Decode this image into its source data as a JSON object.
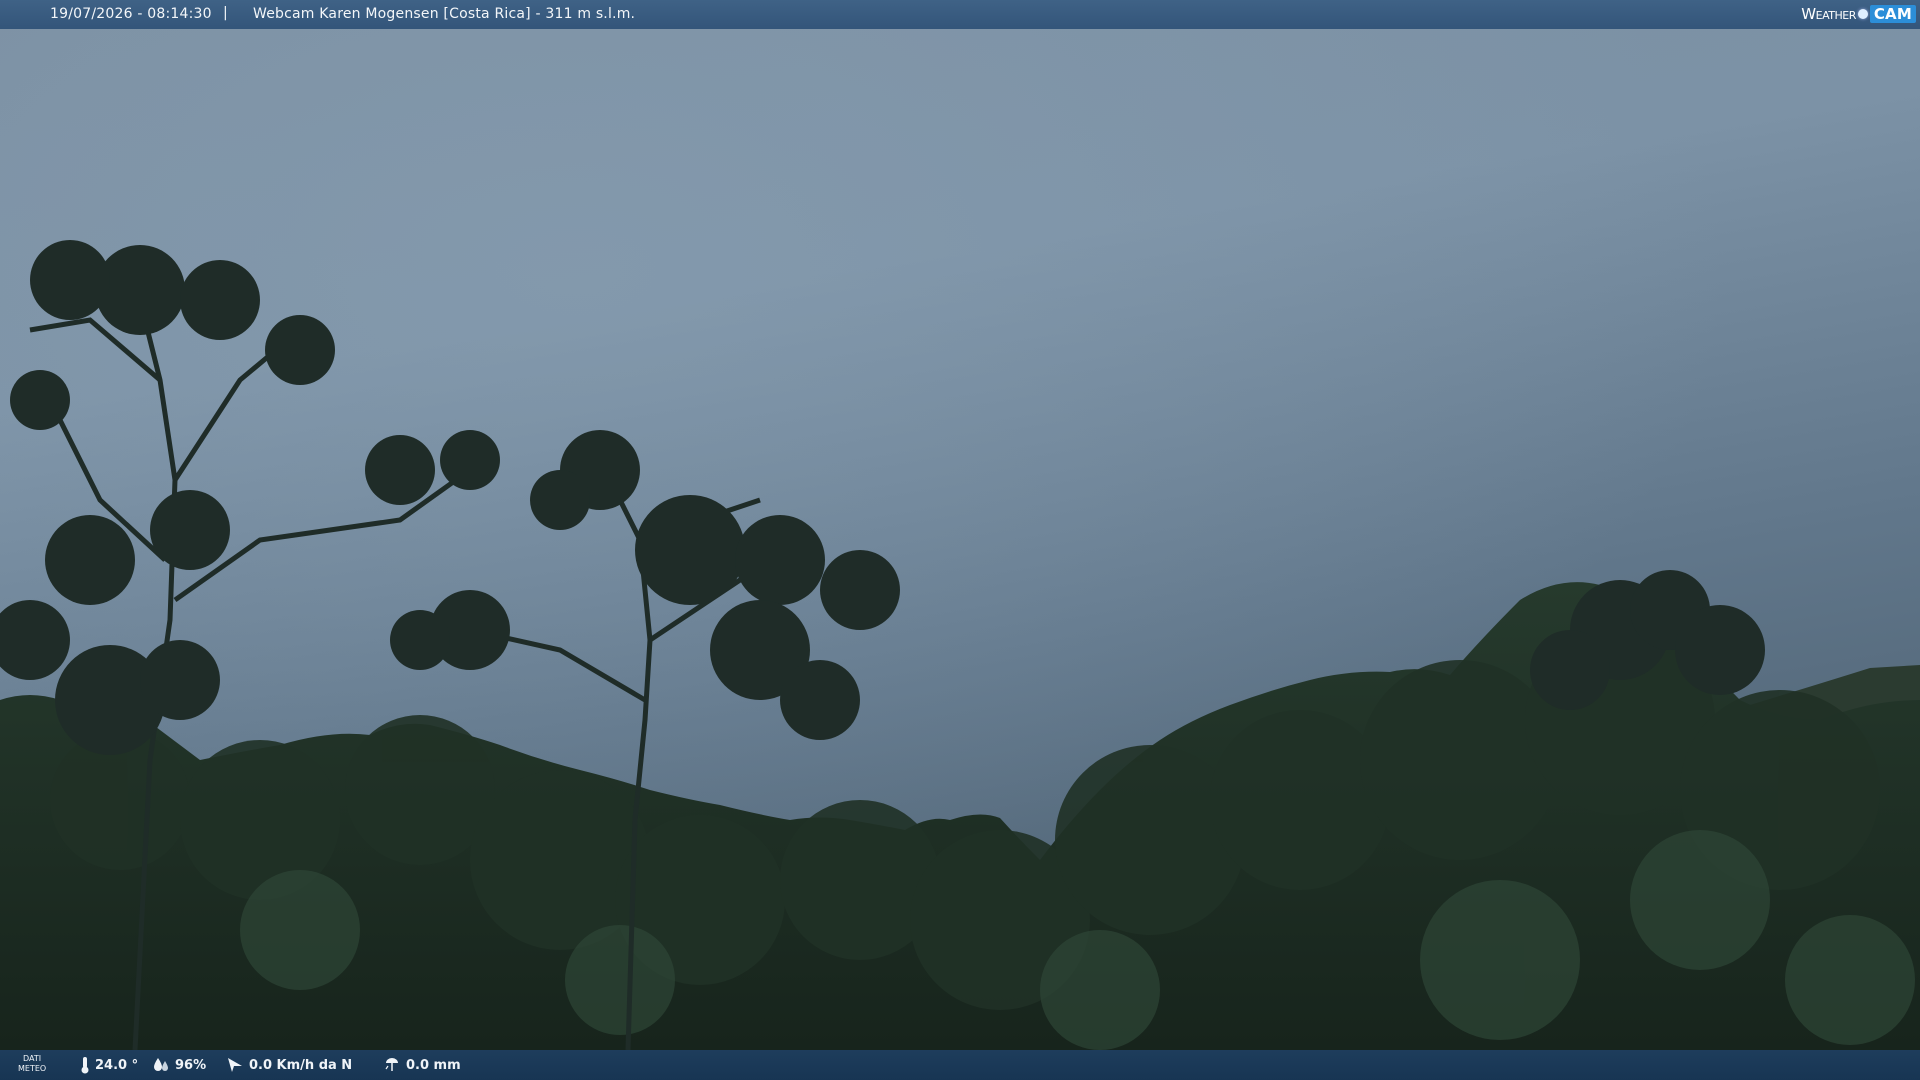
{
  "header": {
    "datetime": "19/07/2026 - 08:14:30",
    "separator": "|",
    "title": "Webcam Karen Mogensen [Costa Rica] - 311 m s.l.m.",
    "logo_weather": "Weather",
    "logo_cam": "CAM"
  },
  "footer": {
    "dati_line1": "DATI",
    "dati_line2": "METEO",
    "temperature": "24.0 °",
    "humidity": "96%",
    "wind": "0.0 Km/h da N",
    "rain": "0.0 mm"
  },
  "icons": {
    "temperature": "thermometer-icon",
    "humidity": "humidity-icon",
    "wind": "wind-icon",
    "rain": "rain-icon"
  },
  "colors": {
    "sky_top": "#7e93a5",
    "sky_bottom": "#5c6f82",
    "foliage": "#1d2b22",
    "bar_top": "#3a5c80",
    "bar_bottom": "#1b3a58"
  }
}
